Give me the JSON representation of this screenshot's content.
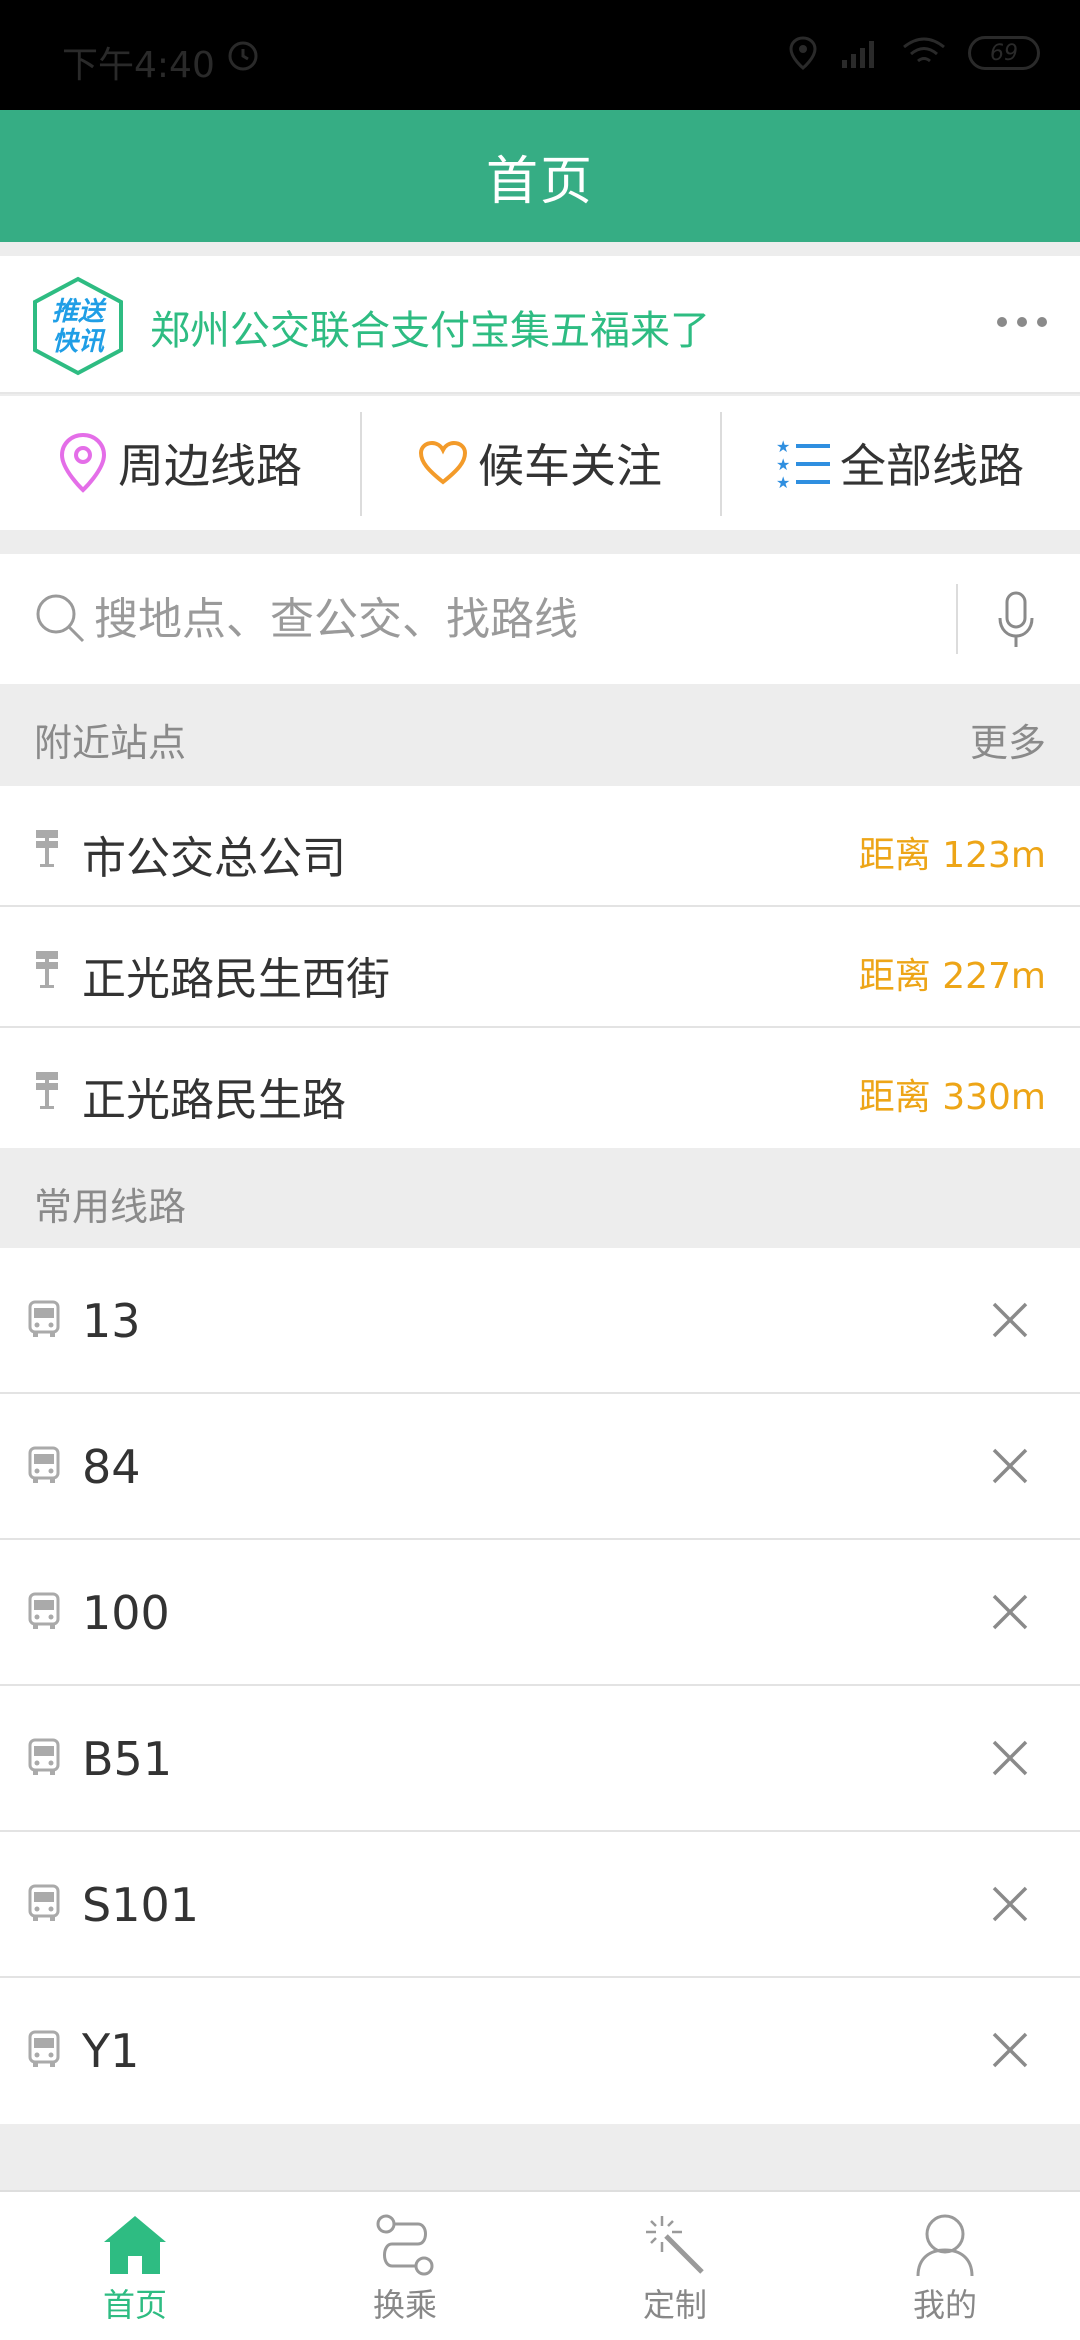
{
  "status_bar": {
    "time": "下午4:40",
    "battery": "69"
  },
  "header": {
    "title": "首页"
  },
  "news": {
    "badge_line1": "推送",
    "badge_line2": "快讯",
    "headline": "郑州公交联合支付宝集五福来了"
  },
  "quick_entries": [
    {
      "label": "周边线路",
      "icon": "location-pin-icon",
      "color": "#e46ee8"
    },
    {
      "label": "候车关注",
      "icon": "heart-icon",
      "color": "#f39b2a"
    },
    {
      "label": "全部线路",
      "icon": "list-icon",
      "color": "#2f8fe0"
    }
  ],
  "search": {
    "placeholder": "搜地点、查公交、找路线"
  },
  "nearby": {
    "title": "附近站点",
    "more": "更多",
    "stations": [
      {
        "name": "市公交总公司",
        "distance": "距离 123m"
      },
      {
        "name": "正光路民生西街",
        "distance": "距离 227m"
      },
      {
        "name": "正光路民生路",
        "distance": "距离 330m"
      }
    ]
  },
  "common": {
    "title": "常用线路",
    "routes": [
      "13",
      "84",
      "100",
      "B51",
      "S101",
      "Y1"
    ]
  },
  "bottom_nav": [
    {
      "label": "首页",
      "icon": "home-icon",
      "active": true
    },
    {
      "label": "换乘",
      "icon": "transfer-icon",
      "active": false
    },
    {
      "label": "定制",
      "icon": "magic-wand-icon",
      "active": false
    },
    {
      "label": "我的",
      "icon": "person-icon",
      "active": false
    }
  ],
  "colors": {
    "brand": "#36ad84",
    "accent_green": "#2ebc82",
    "distance": "#eda517"
  }
}
